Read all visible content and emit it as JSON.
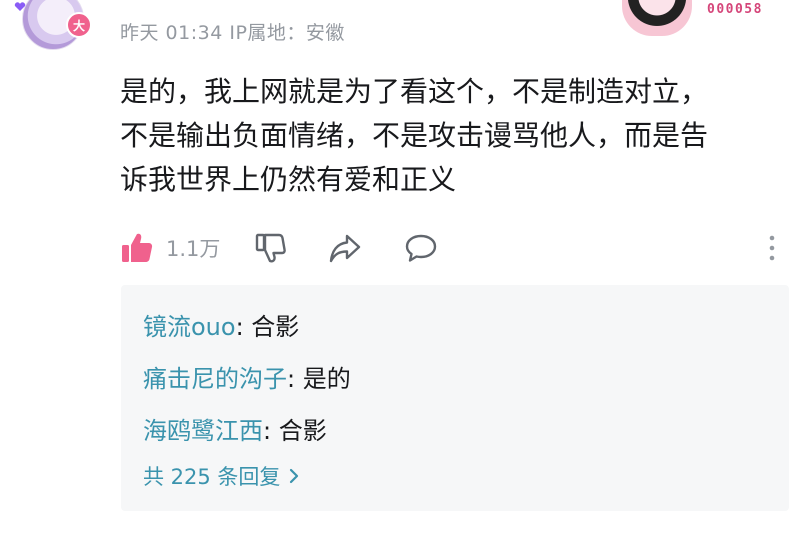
{
  "comment": {
    "meta": "昨天 01:34 IP属地：安徽",
    "badge_text": "大",
    "decoration_number": "000058",
    "lines": [
      "是的，我上网就是为了看这个，不是制造对立，",
      "不是输出负面情绪，不是攻击谩骂他人，而是告",
      "诉我世界上仍然有爱和正义"
    ],
    "likes": "1.1万"
  },
  "icons": [
    "like-icon",
    "dislike-icon",
    "share-icon",
    "comment-icon",
    "more-icon",
    "chevron-right-icon"
  ],
  "colors": {
    "like_active": "#f0618d",
    "username": "#3a93ad",
    "meta": "#9499a0",
    "reply_bg": "#f6f7f8"
  },
  "replies": [
    {
      "user": "镜流ouo",
      "sep": ": ",
      "text": "合影"
    },
    {
      "user": "痛击尼的沟子",
      "sep": ": ",
      "text": "是的"
    },
    {
      "user": "海鸥鹭江西",
      "sep": ": ",
      "text": "合影"
    }
  ],
  "replies_total": "共 225 条回复"
}
